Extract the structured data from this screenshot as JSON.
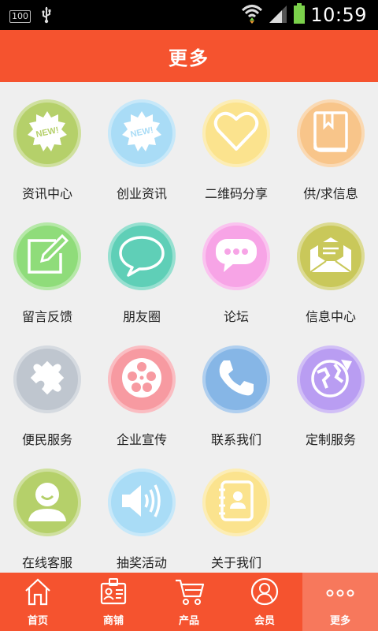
{
  "status_bar": {
    "battery_percent": "100",
    "time": "10:59",
    "icons": [
      "usb-icon",
      "wifi-icon",
      "signal-icon",
      "battery-icon"
    ]
  },
  "header": {
    "title": "更多"
  },
  "grid": {
    "items": [
      {
        "label": "资讯中心",
        "icon": "new-badge-icon",
        "color": "#b5d06a"
      },
      {
        "label": "创业资讯",
        "icon": "new-badge-icon",
        "color": "#a9dcf6"
      },
      {
        "label": "二维码分享",
        "icon": "heart-icon",
        "color": "#fbe38e"
      },
      {
        "label": "供/求信息",
        "icon": "book-icon",
        "color": "#f8c58a"
      },
      {
        "label": "留言反馈",
        "icon": "note-edit-icon",
        "color": "#8fdc7a"
      },
      {
        "label": "朋友圈",
        "icon": "chat-bubble-icon",
        "color": "#5fcfb7"
      },
      {
        "label": "论坛",
        "icon": "chat-dots-icon",
        "color": "#f7a4e6"
      },
      {
        "label": "信息中心",
        "icon": "envelope-icon",
        "color": "#c9c85a"
      },
      {
        "label": "便民服务",
        "icon": "puzzle-icon",
        "color": "#bfc6cf"
      },
      {
        "label": "企业宣传",
        "icon": "film-reel-icon",
        "color": "#f79aa1"
      },
      {
        "label": "联系我们",
        "icon": "phone-icon",
        "color": "#86b6e6"
      },
      {
        "label": "定制服务",
        "icon": "globe-icon",
        "color": "#b99df2"
      },
      {
        "label": "在线客服",
        "icon": "person-icon",
        "color": "#b5d06a"
      },
      {
        "label": "抽奖活动",
        "icon": "speaker-icon",
        "color": "#a9dcf6"
      },
      {
        "label": "关于我们",
        "icon": "contacts-book-icon",
        "color": "#fbe38e"
      }
    ]
  },
  "bottom_nav": {
    "items": [
      {
        "label": "首页",
        "icon": "home-icon"
      },
      {
        "label": "商铺",
        "icon": "shop-card-icon"
      },
      {
        "label": "产品",
        "icon": "cart-icon"
      },
      {
        "label": "会员",
        "icon": "member-icon"
      },
      {
        "label": "更多",
        "icon": "more-dots-icon",
        "active": true
      }
    ]
  },
  "colors": {
    "accent": "#f5532f",
    "background": "#efefef"
  }
}
